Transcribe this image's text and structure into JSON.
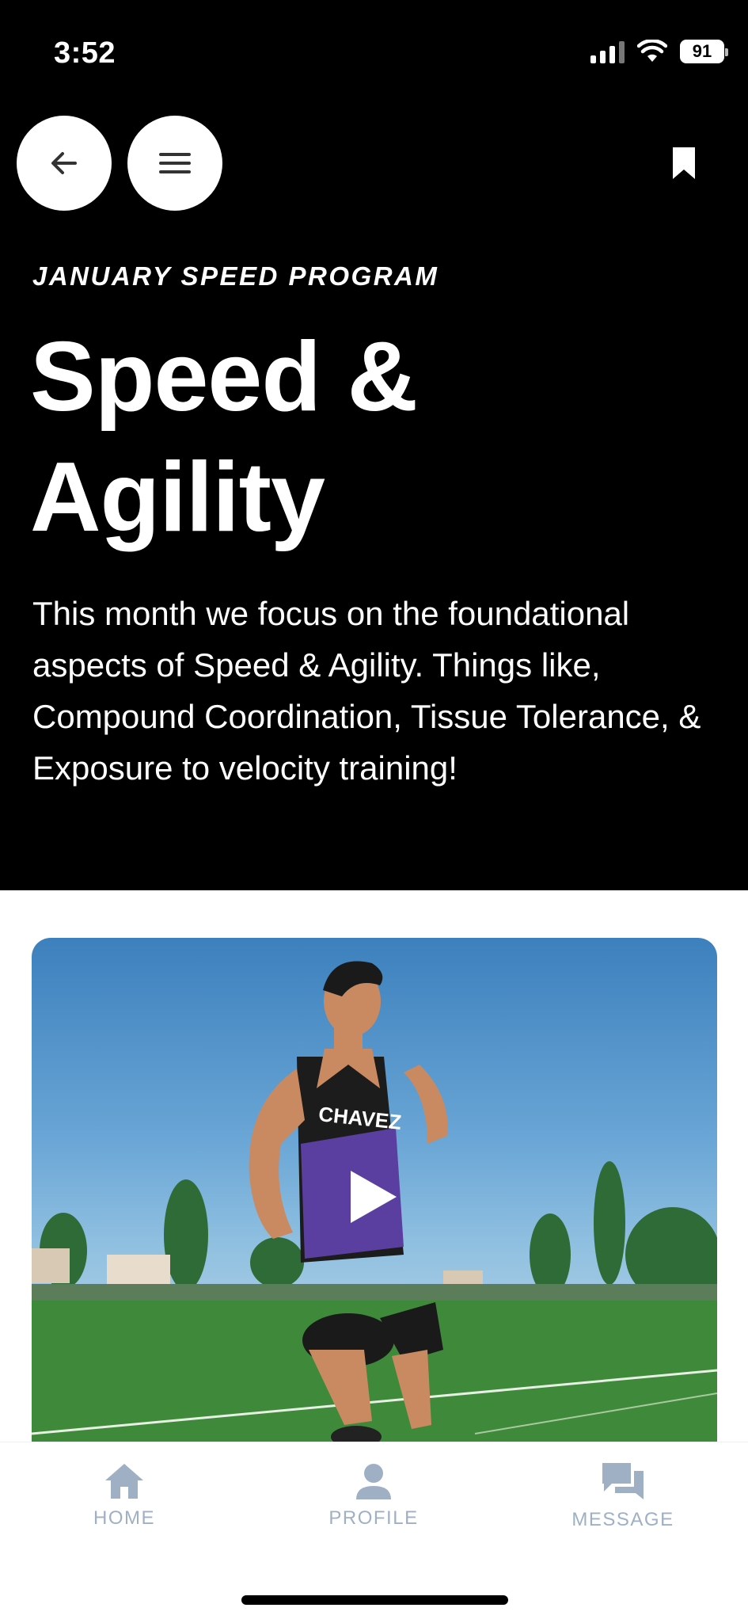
{
  "status_bar": {
    "time": "3:52",
    "battery": "91"
  },
  "header": {
    "eyebrow": "JANUARY SPEED PROGRAM",
    "title": "Speed & Agility"
  },
  "description": "This month we focus on the foundational aspects of Speed & Agility. Things like, Compound Coordination, Tissue Tolerance, & Exposure to velocity training!",
  "video": {
    "jersey_text": "CHAVEZ"
  },
  "nav": {
    "items": [
      {
        "label": "HOME",
        "icon": "home-icon"
      },
      {
        "label": "PROFILE",
        "icon": "profile-icon"
      },
      {
        "label": "MESSAGE",
        "icon": "message-icon"
      }
    ]
  },
  "colors": {
    "hero_bg": "#000000",
    "nav_inactive": "#9fb0c5",
    "accent_white": "#ffffff"
  }
}
